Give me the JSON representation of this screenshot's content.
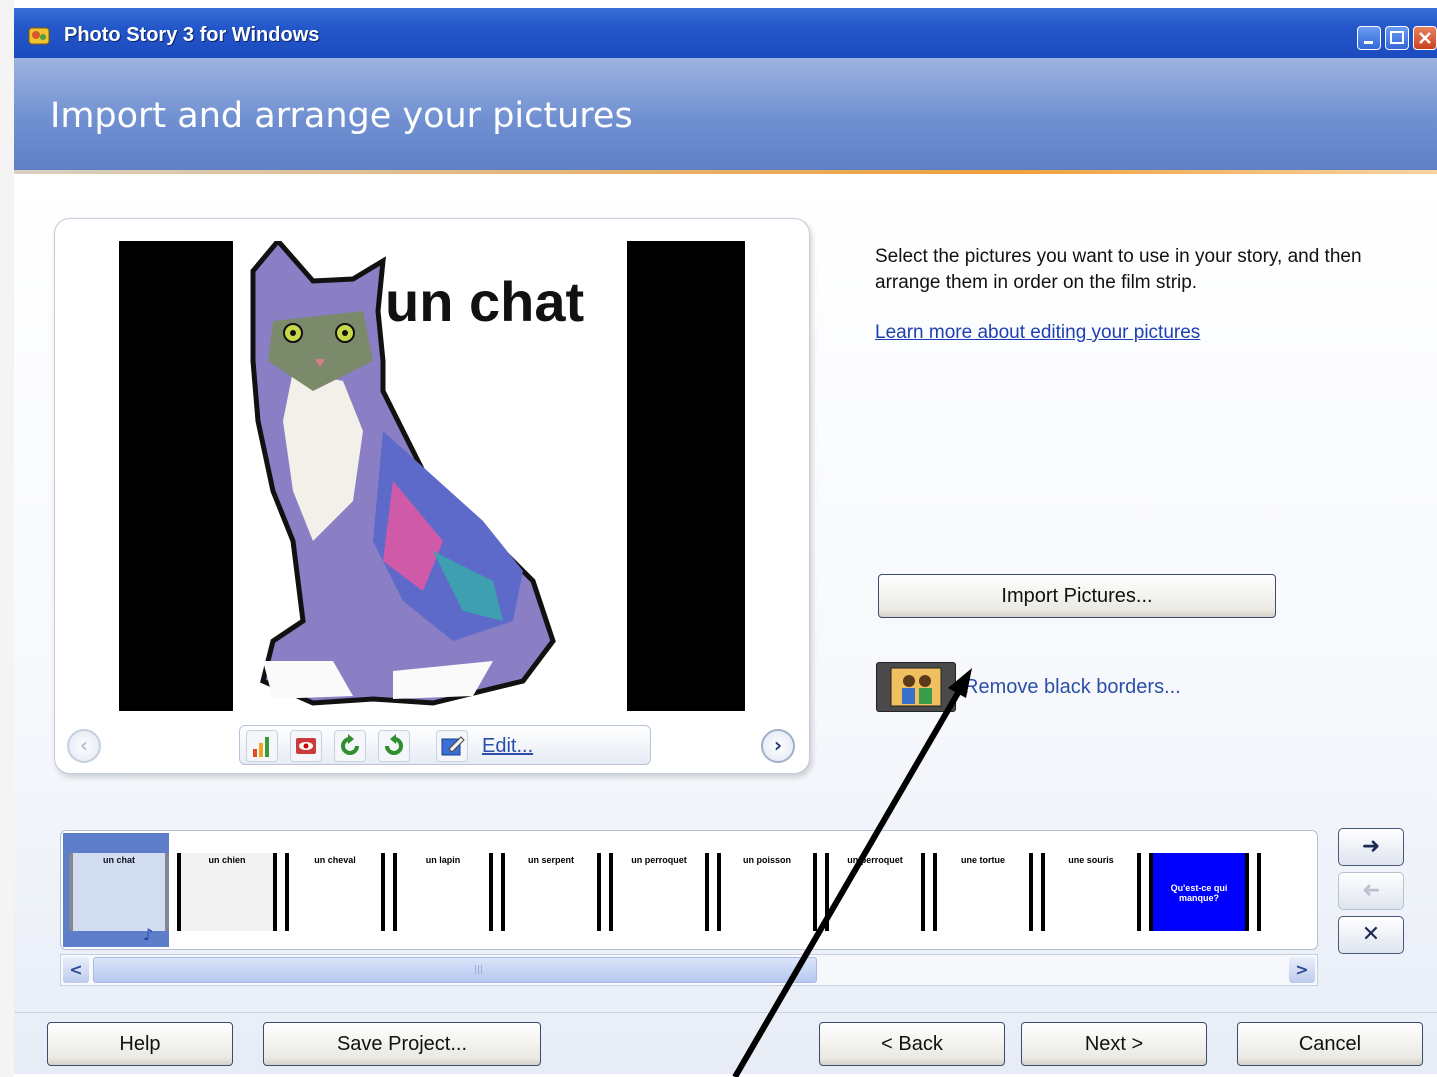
{
  "window": {
    "title": "Photo Story 3 for Windows",
    "app_icon": "photo-story-icon"
  },
  "header": {
    "title": "Import and arrange your pictures"
  },
  "preview": {
    "caption": "un chat",
    "edit_label": "Edit...",
    "toolbar_icons": [
      "auto-color-icon",
      "red-eye-icon",
      "rotate-left-icon",
      "rotate-right-icon",
      "edit-icon"
    ]
  },
  "instructions": {
    "text": "Select the pictures you want to use in your story, and then arrange them in order on the film strip.",
    "learn_more": "Learn more about editing your pictures"
  },
  "actions": {
    "import_pictures": "Import Pictures...",
    "remove_black_borders": "Remove black borders..."
  },
  "filmstrip": {
    "thumbnails": [
      {
        "label": "un chat",
        "bg": "#e8eef8"
      },
      {
        "label": "un chien",
        "bg": "#f2f2f2"
      },
      {
        "label": "un cheval",
        "bg": "#ffffff"
      },
      {
        "label": "un lapin",
        "bg": "#ffffff"
      },
      {
        "label": "un serpent",
        "bg": "#ffffff"
      },
      {
        "label": "un perroquet",
        "bg": "#ffffff"
      },
      {
        "label": "un poisson",
        "bg": "#ffffff"
      },
      {
        "label": "un perroquet",
        "bg": "#ffffff"
      },
      {
        "label": "une tortue",
        "bg": "#ffffff"
      },
      {
        "label": "une souris",
        "bg": "#ffffff"
      },
      {
        "label": "Qu'est-ce qui manque?",
        "bg": "#0000ff"
      },
      {
        "label": "",
        "bg": "#ffffff"
      }
    ],
    "move_right_icon": "arrow-right-icon",
    "move_left_icon": "arrow-left-icon",
    "delete_icon": "x-icon"
  },
  "footer": {
    "help": "Help",
    "save_project": "Save Project...",
    "back": "< Back",
    "next": "Next >",
    "cancel": "Cancel"
  },
  "colors": {
    "titlebar": "#2356c9",
    "header": "#6f8fd1",
    "accent_rule": "#f0a13a",
    "link": "#2b4fa8"
  }
}
